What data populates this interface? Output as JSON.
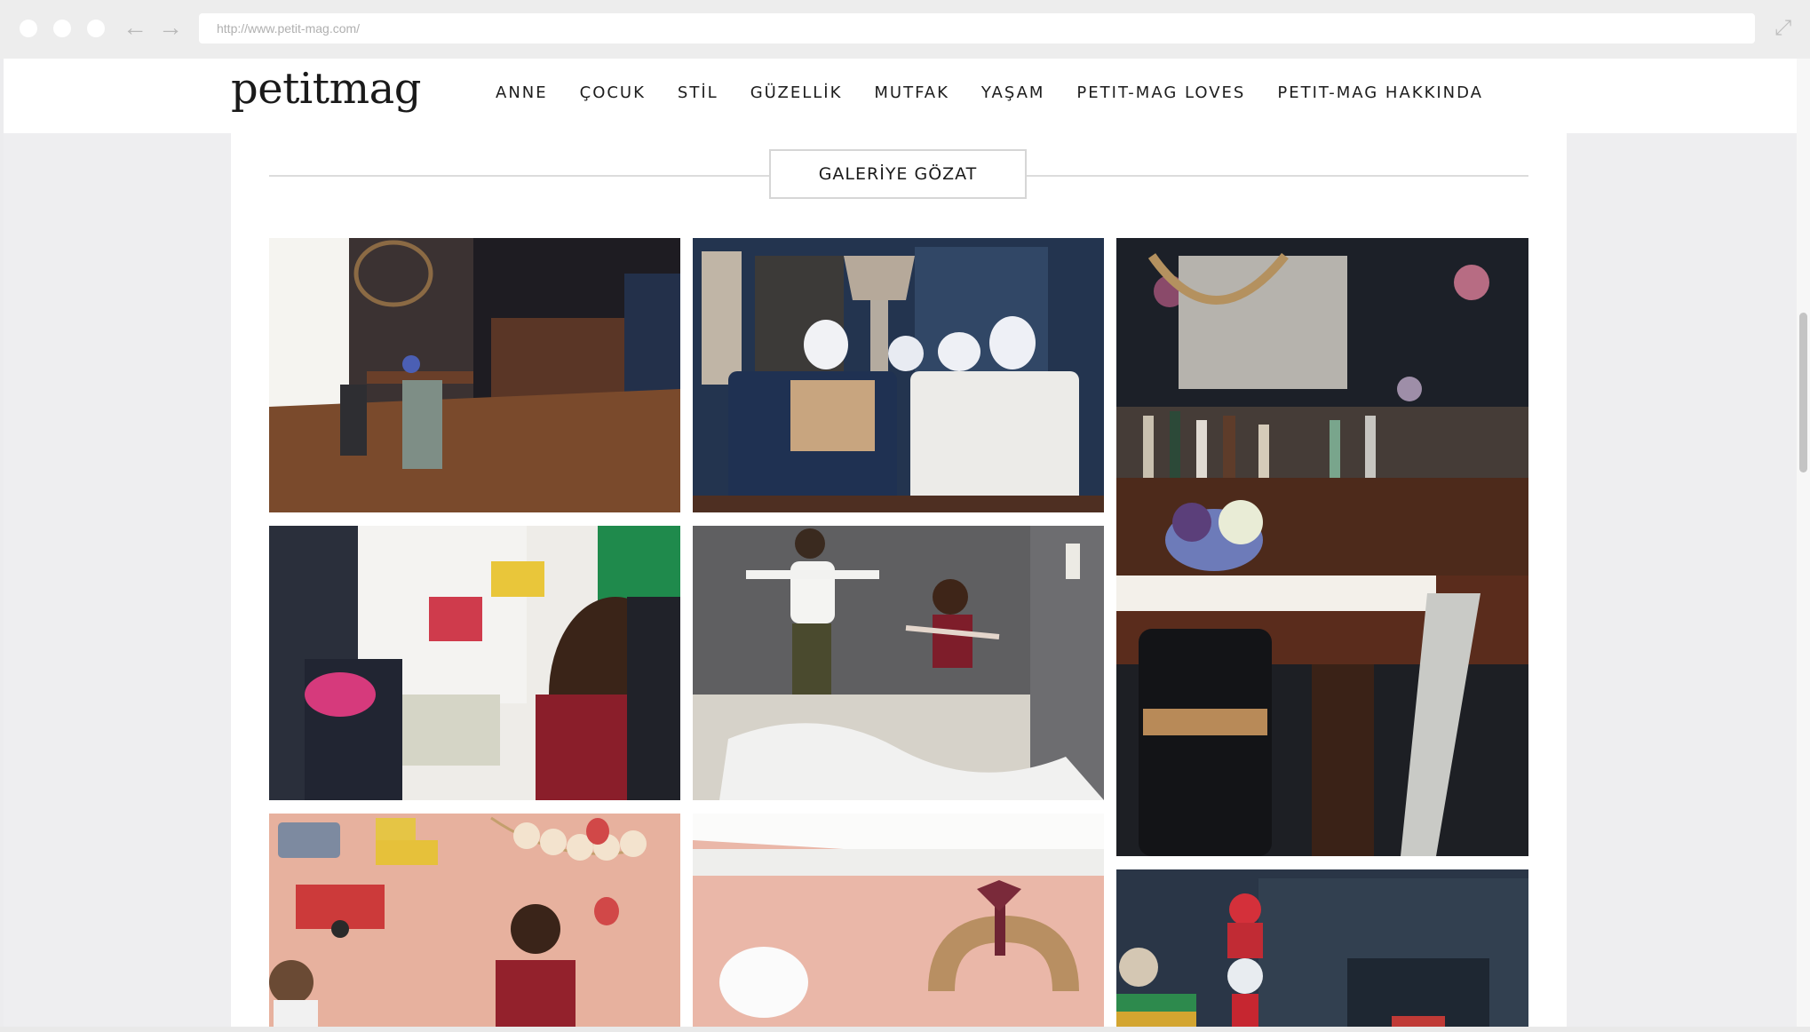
{
  "browser": {
    "url": "http://www.petit-mag.com/",
    "back_icon": "arrow-left-icon",
    "forward_icon": "arrow-right-icon",
    "expand_icon": "expand-icon"
  },
  "site": {
    "logo": "petitmag",
    "menu": [
      "ANNE",
      "ÇOCUK",
      "STİL",
      "GÜZELLİK",
      "MUTFAK",
      "YAŞAM",
      "PETIT-MAG LOVES",
      "PETIT-MAG HAKKINDA"
    ]
  },
  "gallery": {
    "button_label": "GALERİYE GÖZAT",
    "images": [
      "dining-room-chandelier",
      "blue-living-room-armchairs",
      "dining-room-bar-closeup",
      "mother-and-child-playroom",
      "children-jumping-on-bed",
      "pink-kids-room-wall-decals",
      "pink-room-wreath",
      "dark-shelf-collectibles"
    ]
  },
  "colors": {
    "accent_text": "#1a1a1a",
    "navy": "#23344f",
    "pink": "#e3a99b"
  }
}
